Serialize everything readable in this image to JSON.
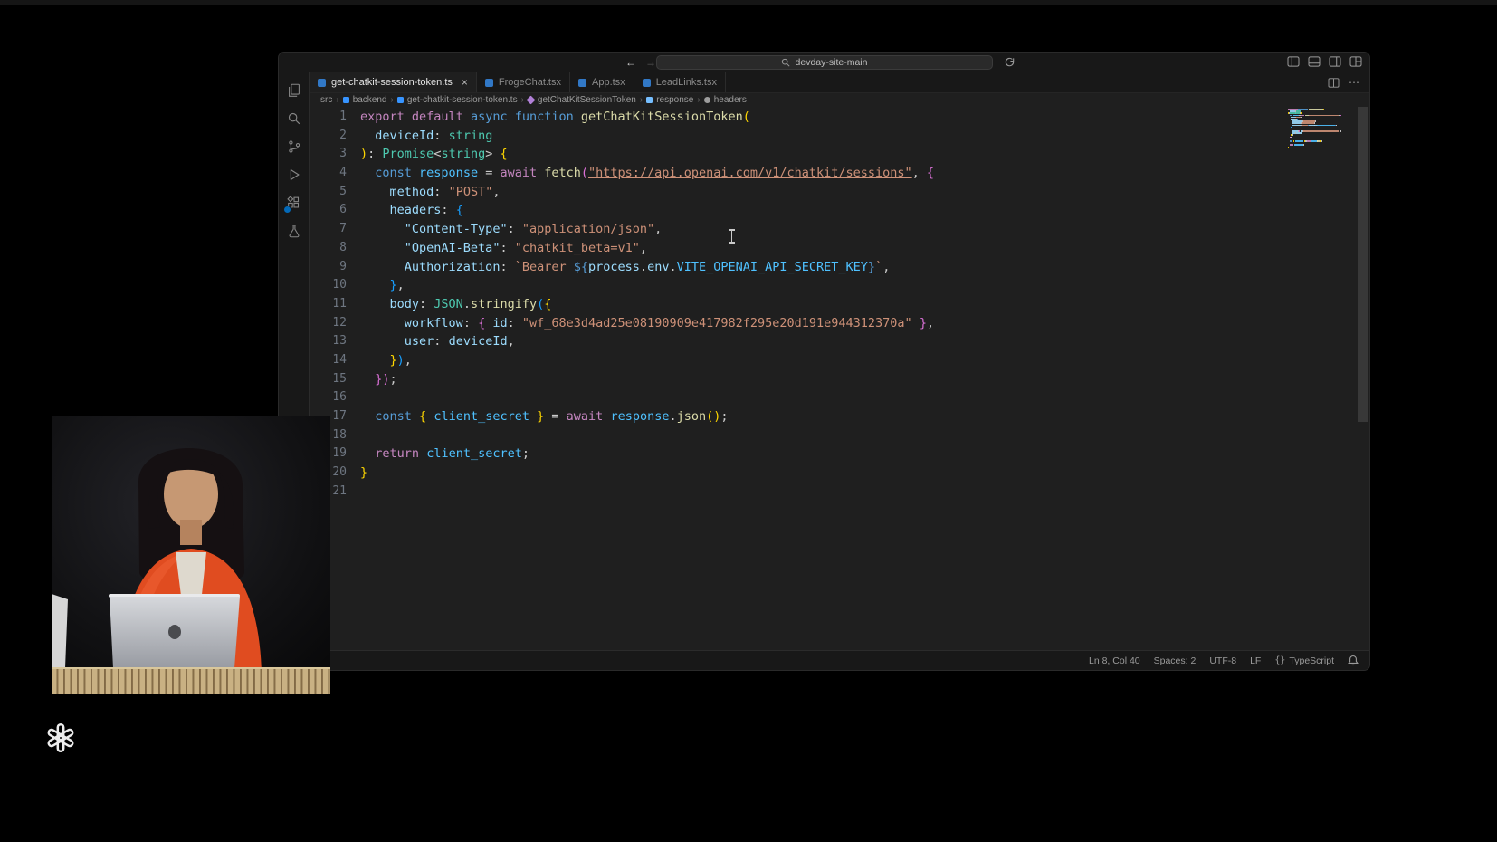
{
  "colors": {
    "editor_bg": "#1f1f1f",
    "chrome_bg": "#181818",
    "badge_accent": "#0078d4",
    "keyword": "#c586c0",
    "declaration": "#569cd6",
    "type": "#4ec9b0",
    "function": "#dcdcaa",
    "variable": "#9cdcfe",
    "constant": "#4fc1ff",
    "string": "#ce9178"
  },
  "titlebar": {
    "back_icon": "←",
    "forward_icon": "→",
    "search_value": "devday-site-main"
  },
  "activity_bar": {
    "items": [
      "explorer",
      "search",
      "source-control",
      "run-and-debug",
      "extensions",
      "testing"
    ],
    "extensions_badge": true
  },
  "tabs": [
    {
      "label": "get-chatkit-session-token.ts",
      "icon": "typescript-file",
      "active": true,
      "close": "×"
    },
    {
      "label": "FrogeChat.tsx",
      "icon": "typescript-react-file",
      "active": false
    },
    {
      "label": "App.tsx",
      "icon": "typescript-react-file",
      "active": false
    },
    {
      "label": "LeadLinks.tsx",
      "icon": "typescript-react-file",
      "active": false
    }
  ],
  "tab_actions": {
    "more": "⋯"
  },
  "breadcrumb": {
    "separator": "›",
    "items": [
      {
        "label": "src"
      },
      {
        "label": "backend",
        "icon": "typescript"
      },
      {
        "label": "get-chatkit-session-token.ts",
        "icon": "typescript"
      },
      {
        "label": "getChatKitSessionToken",
        "icon": "symbol-function"
      },
      {
        "label": "response",
        "icon": "symbol-variable"
      },
      {
        "label": "headers",
        "icon": "symbol-property"
      }
    ]
  },
  "editor": {
    "lines": [
      [
        [
          "export",
          "kw"
        ],
        [
          " ",
          "p"
        ],
        [
          "default",
          "kw"
        ],
        [
          " ",
          "p"
        ],
        [
          "async",
          "decl"
        ],
        [
          " ",
          "p"
        ],
        [
          "function",
          "decl"
        ],
        [
          " ",
          "p"
        ],
        [
          "getChatKitSessionToken",
          "fn"
        ],
        [
          "(",
          "b1"
        ]
      ],
      [
        [
          "  ",
          "p"
        ],
        [
          "deviceId",
          "var"
        ],
        [
          ": ",
          "p"
        ],
        [
          "string",
          "type"
        ]
      ],
      [
        [
          ")",
          "b1"
        ],
        [
          ": ",
          "p"
        ],
        [
          "Promise",
          "type"
        ],
        [
          "<",
          "p"
        ],
        [
          "string",
          "type"
        ],
        [
          ">",
          "p"
        ],
        [
          " ",
          "p"
        ],
        [
          "{",
          "b1"
        ]
      ],
      [
        [
          "  ",
          "p"
        ],
        [
          "const",
          "decl"
        ],
        [
          " ",
          "p"
        ],
        [
          "response",
          "cst"
        ],
        [
          " = ",
          "p"
        ],
        [
          "await",
          "kw"
        ],
        [
          " ",
          "p"
        ],
        [
          "fetch",
          "fn"
        ],
        [
          "(",
          "b2"
        ],
        [
          "\"https://api.openai.com/v1/chatkit/sessions\"",
          "strl"
        ],
        [
          ", ",
          "p"
        ],
        [
          "{",
          "b2"
        ]
      ],
      [
        [
          "    ",
          "p"
        ],
        [
          "method",
          "var"
        ],
        [
          ": ",
          "p"
        ],
        [
          "\"POST\"",
          "str"
        ],
        [
          ",",
          "p"
        ]
      ],
      [
        [
          "    ",
          "p"
        ],
        [
          "headers",
          "var"
        ],
        [
          ": ",
          "p"
        ],
        [
          "{",
          "b3"
        ]
      ],
      [
        [
          "      ",
          "p"
        ],
        [
          "\"Content-Type\"",
          "var"
        ],
        [
          ": ",
          "p"
        ],
        [
          "\"application/json\"",
          "str"
        ],
        [
          ",",
          "p"
        ]
      ],
      [
        [
          "      ",
          "p"
        ],
        [
          "\"OpenAI-Beta\"",
          "var"
        ],
        [
          ": ",
          "p"
        ],
        [
          "\"chatkit_beta=v1\"",
          "str"
        ],
        [
          ",",
          "p"
        ]
      ],
      [
        [
          "      ",
          "p"
        ],
        [
          "Authorization",
          "var"
        ],
        [
          ": ",
          "p"
        ],
        [
          "`Bearer ",
          "str"
        ],
        [
          "${",
          "decl"
        ],
        [
          "process",
          "var"
        ],
        [
          ".",
          "p"
        ],
        [
          "env",
          "var"
        ],
        [
          ".",
          "p"
        ],
        [
          "VITE_OPENAI_API_SECRET_KEY",
          "cst"
        ],
        [
          "}",
          "decl"
        ],
        [
          "`",
          "str"
        ],
        [
          ",",
          "p"
        ]
      ],
      [
        [
          "    ",
          "p"
        ],
        [
          "}",
          "b3"
        ],
        [
          ",",
          "p"
        ]
      ],
      [
        [
          "    ",
          "p"
        ],
        [
          "body",
          "var"
        ],
        [
          ": ",
          "p"
        ],
        [
          "JSON",
          "type"
        ],
        [
          ".",
          "p"
        ],
        [
          "stringify",
          "fn"
        ],
        [
          "(",
          "b3"
        ],
        [
          "{",
          "b1"
        ]
      ],
      [
        [
          "      ",
          "p"
        ],
        [
          "workflow",
          "var"
        ],
        [
          ": ",
          "p"
        ],
        [
          "{",
          "b2"
        ],
        [
          " ",
          "p"
        ],
        [
          "id",
          "var"
        ],
        [
          ": ",
          "p"
        ],
        [
          "\"wf_68e3d4ad25e08190909e417982f295e20d191e944312370a\"",
          "str"
        ],
        [
          " ",
          "p"
        ],
        [
          "}",
          "b2"
        ],
        [
          ",",
          "p"
        ]
      ],
      [
        [
          "      ",
          "p"
        ],
        [
          "user",
          "var"
        ],
        [
          ": ",
          "p"
        ],
        [
          "deviceId",
          "var"
        ],
        [
          ",",
          "p"
        ]
      ],
      [
        [
          "    ",
          "p"
        ],
        [
          "}",
          "b1"
        ],
        [
          ")",
          "b3"
        ],
        [
          ",",
          "p"
        ]
      ],
      [
        [
          "  ",
          "p"
        ],
        [
          "}",
          "b2"
        ],
        [
          ")",
          "b2"
        ],
        [
          ";",
          "p"
        ]
      ],
      [],
      [
        [
          "  ",
          "p"
        ],
        [
          "const",
          "decl"
        ],
        [
          " ",
          "p"
        ],
        [
          "{",
          "b1"
        ],
        [
          " ",
          "p"
        ],
        [
          "client_secret",
          "cst"
        ],
        [
          " ",
          "p"
        ],
        [
          "}",
          "b1"
        ],
        [
          " = ",
          "p"
        ],
        [
          "await",
          "kw"
        ],
        [
          " ",
          "p"
        ],
        [
          "response",
          "cst"
        ],
        [
          ".",
          "p"
        ],
        [
          "json",
          "fn"
        ],
        [
          "(",
          "b1"
        ],
        [
          ")",
          "b1"
        ],
        [
          ";",
          "p"
        ]
      ],
      [],
      [
        [
          "  ",
          "p"
        ],
        [
          "return",
          "kw"
        ],
        [
          " ",
          "p"
        ],
        [
          "client_secret",
          "cst"
        ],
        [
          ";",
          "p"
        ]
      ],
      [
        [
          "}",
          "b1"
        ]
      ],
      []
    ]
  },
  "status_bar": {
    "cursor_position": "Ln 8, Col 40",
    "indentation": "Spaces: 2",
    "encoding": "UTF-8",
    "eol": "LF",
    "language_icon": "{}",
    "language": "TypeScript"
  },
  "overlays": {
    "webcam": "presenter-video",
    "logo": "openai-logo"
  }
}
